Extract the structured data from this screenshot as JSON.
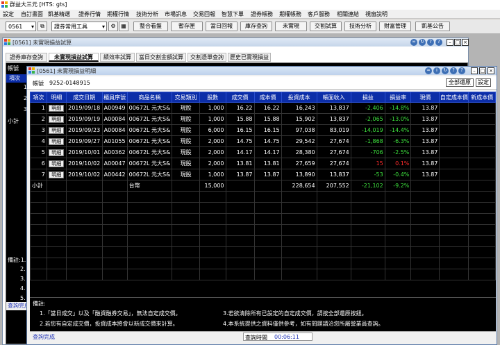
{
  "app": {
    "title": "群益大三元 [HTS: gts]"
  },
  "menu": [
    "設定",
    "自訂畫面",
    "凱基精選",
    "證券行情",
    "期權行情",
    "技術分析",
    "市場訊息",
    "交易回報",
    "智慧下單",
    "證券帳務",
    "期權帳務",
    "客戶服務",
    "相關連結",
    "視窗說明"
  ],
  "toolbar": {
    "stock_code": "0561",
    "tool_select": "證券常用工具",
    "buttons": [
      "整合看盤",
      "暫存匣",
      "當日回報",
      "庫存查詢",
      "未實現",
      "交割試算",
      "技術分析",
      "財富管理",
      "凱基公告"
    ]
  },
  "win1": {
    "title": "[0561] 未實現損益試算",
    "tabs": [
      "證券庫存查詢",
      "未實現損益試算",
      "績效率試算",
      "當日交割金額試算",
      "交割憑單查詢",
      "歷史已實現損益"
    ],
    "account_label": "帳號",
    "left_items": [
      "項次",
      "1",
      "2",
      "3",
      "小計",
      "備註:1.",
      "2.",
      "3.",
      "4.",
      "5.",
      "查詢完成"
    ]
  },
  "win2": {
    "title": "[0561] 未實現損益明細",
    "account_label": "帳號",
    "account_no": "9252-0148915",
    "btn_clear": "全部還原",
    "btn_set": "設定",
    "columns": [
      "項次",
      "明細",
      "成交日期",
      "櫃員序號",
      "商品名稱",
      "交易類別",
      "股數",
      "成交價",
      "成本價",
      "投資成本",
      "帳面收入",
      "損益",
      "損益率",
      "現價",
      "自定成本價",
      "新成本價"
    ],
    "detail_label": "明細",
    "rows": [
      {
        "n": "1",
        "date": "2019/09/18",
        "serial": "A00949",
        "name": "00672L 元大S&",
        "type": "現股",
        "shares": "1,000",
        "price": "16.22",
        "cost": "16.22",
        "invest": "16,243",
        "income": "13,837",
        "pl": "-2,406",
        "rate": "-14.8%",
        "now": "13.87"
      },
      {
        "n": "2",
        "date": "2019/09/19",
        "serial": "A00084",
        "name": "00672L 元大S&",
        "type": "現股",
        "shares": "1,000",
        "price": "15.88",
        "cost": "15.88",
        "invest": "15,902",
        "income": "13,837",
        "pl": "-2,065",
        "rate": "-13.0%",
        "now": "13.87"
      },
      {
        "n": "3",
        "date": "2019/09/23",
        "serial": "A00084",
        "name": "00672L 元大S&",
        "type": "現股",
        "shares": "6,000",
        "price": "16.15",
        "cost": "16.15",
        "invest": "97,038",
        "income": "83,019",
        "pl": "-14,019",
        "rate": "-14.4%",
        "now": "13.87"
      },
      {
        "n": "4",
        "date": "2019/09/27",
        "serial": "A01055",
        "name": "00672L 元大S&",
        "type": "現股",
        "shares": "2,000",
        "price": "14.75",
        "cost": "14.75",
        "invest": "29,542",
        "income": "27,674",
        "pl": "-1,868",
        "rate": "-6.3%",
        "now": "13.87"
      },
      {
        "n": "5",
        "date": "2019/10/01",
        "serial": "A00362",
        "name": "00672L 元大S&",
        "type": "現股",
        "shares": "2,000",
        "price": "14.17",
        "cost": "14.17",
        "invest": "28,380",
        "income": "27,674",
        "pl": "-706",
        "rate": "-2.5%",
        "now": "13.87"
      },
      {
        "n": "6",
        "date": "2019/10/02",
        "serial": "A00047",
        "name": "00672L 元大S&",
        "type": "現股",
        "shares": "2,000",
        "price": "13.81",
        "cost": "13.81",
        "invest": "27,659",
        "income": "27,674",
        "pl": "15",
        "rate": "0.1%",
        "now": "13.87"
      },
      {
        "n": "7",
        "date": "2019/10/02",
        "serial": "A00442",
        "name": "00672L 元大S&",
        "type": "現股",
        "shares": "1,000",
        "price": "13.87",
        "cost": "13.87",
        "invest": "13,890",
        "income": "13,837",
        "pl": "-53",
        "rate": "-0.4%",
        "now": "13.87"
      }
    ],
    "subtotal": {
      "label": "小計",
      "name": "台幣",
      "shares": "15,000",
      "invest": "228,654",
      "income": "207,552",
      "pl": "-21,102",
      "rate": "-9.2%"
    },
    "notes_title": "備註:",
    "notes": [
      "1.「當日成交」以及「融資融券交易」，無法自定成交價。",
      "2.若您有自定成交價，投資成本將會以新成交價來計算。",
      "3.若欲清除所有已設定的自定成交價，請按全部還原按鈕。",
      "4.本系統提供之資料僅供參考，如有問題請洽您所屬營業員查詢。"
    ],
    "status": "查詢完成",
    "query_time_label": "查詢時間",
    "query_time": "00:06:11"
  },
  "colors": {
    "header_blue": "#0c2ea8",
    "loss_green": "#3ee23e",
    "gain_red": "#ff2c2c"
  }
}
